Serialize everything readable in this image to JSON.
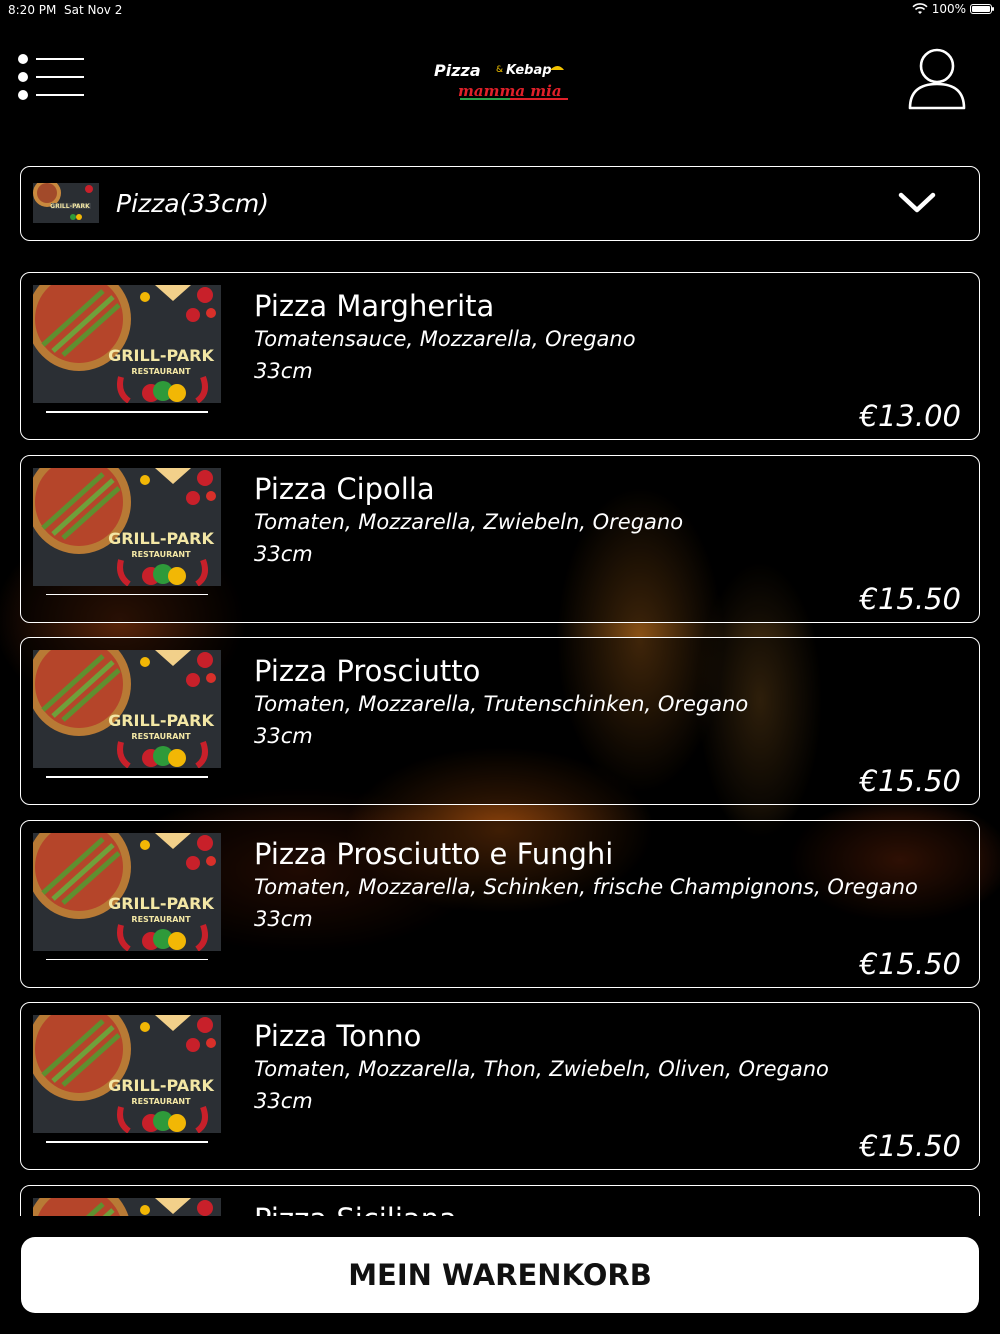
{
  "status_bar": {
    "time": "8:20 PM",
    "date": "Sat Nov 2",
    "battery": "100%"
  },
  "header": {
    "menu_icon": "menu-list-icon",
    "logo_text": {
      "pizza": "Pizza",
      "amp": "&",
      "kebap": "Kebap",
      "mamma": "mamma mia"
    },
    "profile_icon": "user-profile-icon"
  },
  "category": {
    "selected": "Pizza(33cm)",
    "icon": "chevron-down-icon"
  },
  "thumb_text": {
    "line1": "GRILL-PARK",
    "line2": "RESTAURANT"
  },
  "products": [
    {
      "name": "Pizza Margherita",
      "description": "Tomatensauce, Mozzarella, Oregano",
      "size": "33cm",
      "price": "€13.00"
    },
    {
      "name": "Pizza Cipolla",
      "description": "Tomaten, Mozzarella, Zwiebeln, Oregano",
      "size": "33cm",
      "price": "€15.50"
    },
    {
      "name": "Pizza Prosciutto",
      "description": "Tomaten, Mozzarella, Trutenschinken, Oregano",
      "size": "33cm",
      "price": "€15.50"
    },
    {
      "name": "Pizza Prosciutto e Funghi",
      "description": "Tomaten, Mozzarella, Schinken, frische Champignons, Oregano",
      "size": "33cm",
      "price": "€15.50"
    },
    {
      "name": "Pizza Tonno",
      "description": "Tomaten, Mozzarella, Thon, Zwiebeln, Oliven, Oregano",
      "size": "33cm",
      "price": "€15.50"
    },
    {
      "name": "Pizza Siciliana",
      "description": "",
      "size": "",
      "price": ""
    }
  ],
  "cart": {
    "label": "MEIN WARENKORB"
  },
  "colors": {
    "background": "#000000",
    "border": "#ffffff",
    "button_bg": "#ffffff",
    "button_text": "#111111",
    "flame": "#ff8a1e"
  }
}
